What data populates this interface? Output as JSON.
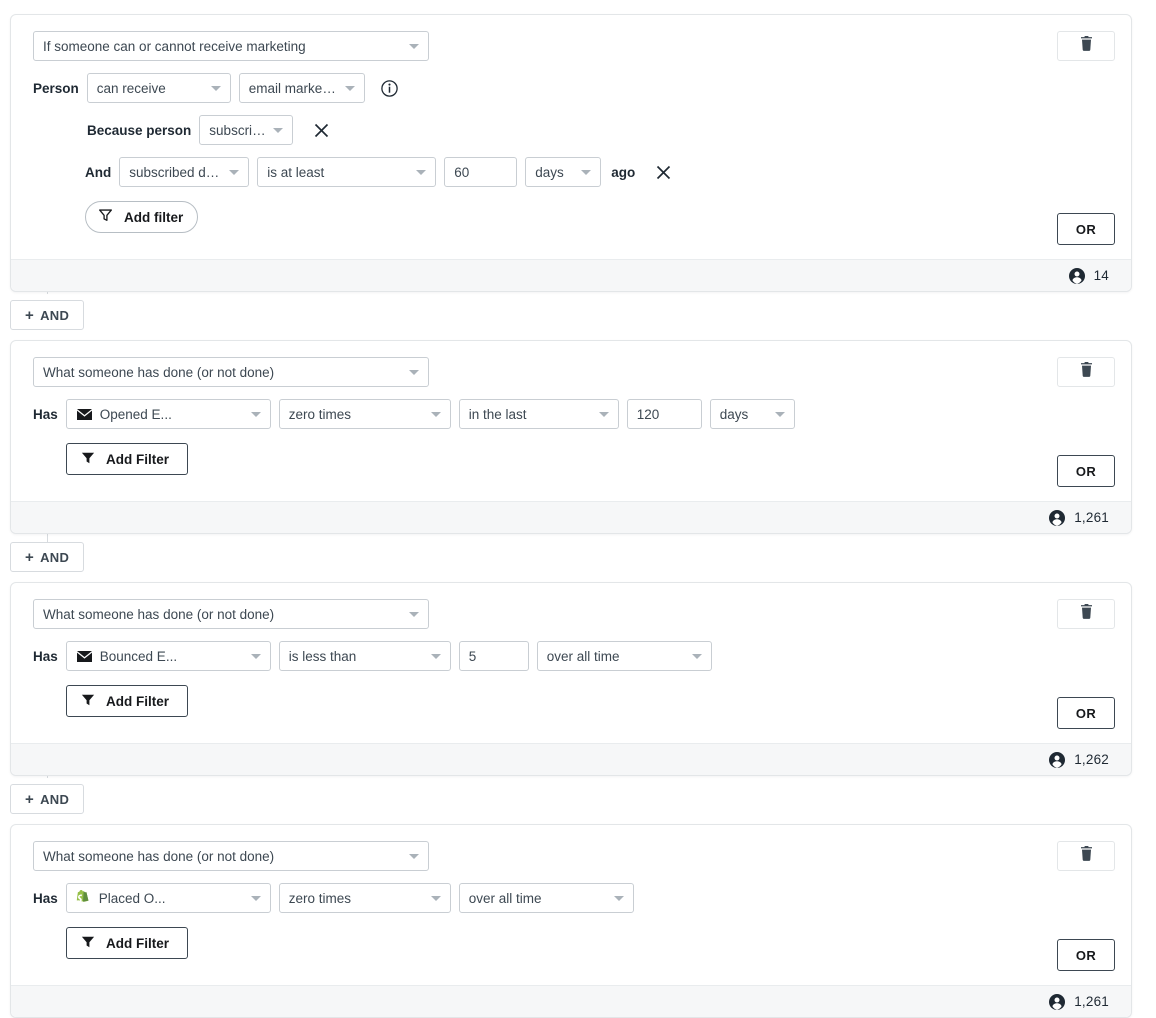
{
  "connector_color": "#d7dbdf",
  "shopify_green": "#95BF47",
  "blocks": [
    {
      "type_label": "If someone can or cannot receive marketing",
      "delete_icon": "trash-icon",
      "rows": [
        {
          "label": "Person",
          "can_receive": "can receive",
          "channel": "email marketing",
          "info_icon": "info-icon"
        },
        {
          "label": "Because person",
          "value": "subscribed",
          "remove_icon": "close-icon"
        },
        {
          "label": "And",
          "field": "subscribed date",
          "operator": "is at least",
          "number": "60",
          "unit": "days",
          "suffix": "ago",
          "remove_icon": "close-icon"
        }
      ],
      "add_filter_label": "Add filter",
      "filter_icon": "filter-funnel-icon",
      "or_label": "OR",
      "count": "14",
      "count_icon": "person-icon"
    },
    {
      "type_label": "What someone has done (or not done)",
      "delete_icon": "trash-icon",
      "has_label": "Has",
      "metric": "Opened E...",
      "metric_icon": "email-metric-icon",
      "frequency": "zero times",
      "timeframe": "in the last",
      "number": "120",
      "unit": "days",
      "add_filter_label": "Add Filter",
      "filter_icon": "filter-funnel-icon",
      "or_label": "OR",
      "count": "1,261",
      "count_icon": "person-icon"
    },
    {
      "type_label": "What someone has done (or not done)",
      "delete_icon": "trash-icon",
      "has_label": "Has",
      "metric": "Bounced E...",
      "metric_icon": "email-metric-icon",
      "frequency": "is less than",
      "number": "5",
      "timeframe": "over all time",
      "add_filter_label": "Add Filter",
      "filter_icon": "filter-funnel-icon",
      "or_label": "OR",
      "count": "1,262",
      "count_icon": "person-icon"
    },
    {
      "type_label": "What someone has done (or not done)",
      "delete_icon": "trash-icon",
      "has_label": "Has",
      "metric": "Placed O...",
      "metric_icon": "shopify-icon",
      "frequency": "zero times",
      "timeframe": "over all time",
      "add_filter_label": "Add Filter",
      "filter_icon": "filter-funnel-icon",
      "or_label": "OR",
      "count": "1,261",
      "count_icon": "person-icon"
    }
  ],
  "and_connectors": [
    {
      "label": "AND",
      "plus": "+"
    },
    {
      "label": "AND",
      "plus": "+"
    },
    {
      "label": "AND",
      "plus": "+"
    }
  ]
}
